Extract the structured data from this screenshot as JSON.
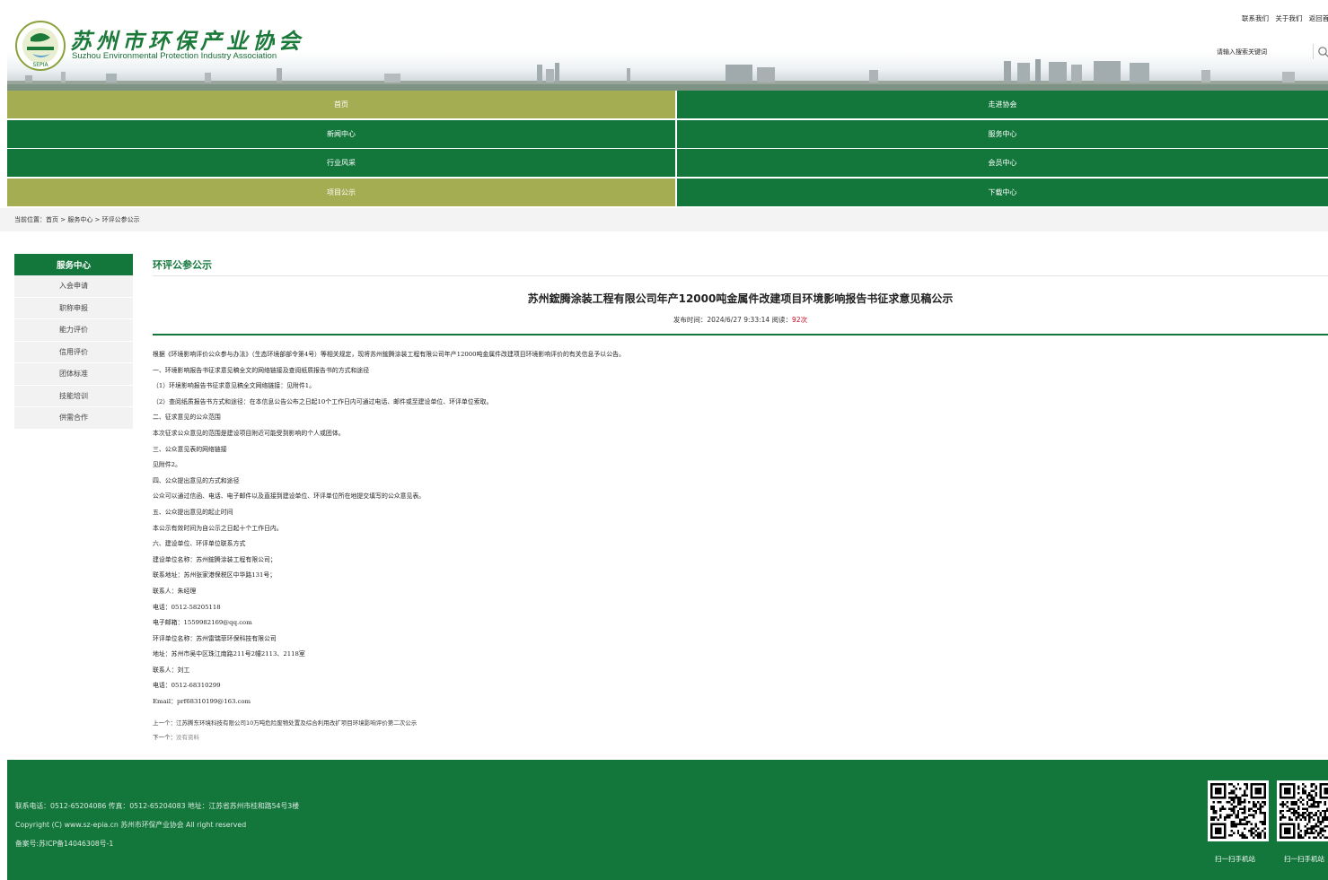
{
  "header": {
    "logo_cn": "苏州市环保产业协会",
    "logo_en": "Suzhou Environmental Protection Industry Association",
    "top_links": [
      "联系我们",
      "关于我们",
      "返回首页"
    ],
    "search_placeholder": "请输入搜索关键词"
  },
  "nav": [
    {
      "label": "首页",
      "active": true
    },
    {
      "label": "走进协会",
      "active": false
    },
    {
      "label": "新闻中心",
      "active": false
    },
    {
      "label": "服务中心",
      "active": false
    },
    {
      "label": "行业风采",
      "active": false
    },
    {
      "label": "会员中心",
      "active": false
    },
    {
      "label": "项目公示",
      "active": true
    },
    {
      "label": "下载中心",
      "active": false
    }
  ],
  "breadcrumb": "当前位置：首页 > 服务中心 > 环评公参公示",
  "sidebar": {
    "title": "服务中心",
    "items": [
      "入会申请",
      "职称申报",
      "能力评价",
      "信用评价",
      "团体标准",
      "技能培训",
      "供需合作"
    ]
  },
  "section_title": "环评公参公示",
  "article": {
    "title": "苏州鋐腾涂装工程有限公司年产12000吨金属件改建项目环境影响报告书征求意见稿公示",
    "meta_prefix": "发布时间：2024/6/27 9:33:14   阅读：",
    "hits": "92次",
    "body": [
      "根据《环境影响评价公众参与办法》（生态环境部部令第4号）等相关规定，现将苏州鋐腾涂装工程有限公司年产12000吨金属件改建项目环境影响评价的有关信息予以公告。",
      "一、环境影响报告书征求意见稿全文的网络链接及查阅纸质报告书的方式和途径",
      "（1）环境影响报告书征求意见稿全文网络链接：见附件1。",
      "（2）查阅纸质报告书方式和途径：在本信息公告公布之日起10个工作日内可通过电话、邮件或至建设单位、环评单位索取。",
      "二、征求意见的公众范围",
      "本次征求公众意见的范围是建设项目附近可能受到影响的个人或团体。",
      "三、公众意见表的网络链接",
      "见附件2。",
      "四、公众提出意见的方式和途径",
      "公众可以通过信函、电话、电子邮件以及直接到建设单位、环评单位所在地提交填写的公众意见表。",
      "五、公众提出意见的起止时间",
      "本公示有效时间为自公示之日起十个工作日内。",
      "六、建设单位、环评单位联系方式",
      "建设单位名称：苏州鋐腾涂装工程有限公司；",
      "联系地址：苏州张家港保税区中华路131号；",
      "联系人：朱经理",
      "电话：0512-58205118",
      "电子邮箱：1559982169@qq.com",
      "环评单位名称：苏州雷瑞菲环保科技有限公司",
      "地址：苏州市吴中区珠江南路211号2幢2113、2118室",
      "联系人：刘工",
      "电话：0512-68310299",
      "Email：prf68310199@163.com"
    ],
    "prev_label": "上一个：",
    "prev_text": "江苏腾东环境科技有限公司10万吨危险废物处置及综合利用改扩项目环境影响评价第二次公示",
    "next_label": "下一个：",
    "next_text": "没有资料"
  },
  "footer": {
    "lines": [
      "联系电话：0512-65204086 传真：0512-65204083 地址：江苏省苏州市桂和路54号3楼",
      "Copyright (C) www.sz-epia.cn 苏州市环保产业协会 All right reserved",
      "备案号:苏ICP备14046308号-1"
    ],
    "qr_captions": [
      "扫一扫手机站",
      "扫一扫手机站"
    ]
  },
  "colors": {
    "green": "#13773c",
    "olive": "#a5ad53",
    "hit_red": "#d0021b"
  }
}
